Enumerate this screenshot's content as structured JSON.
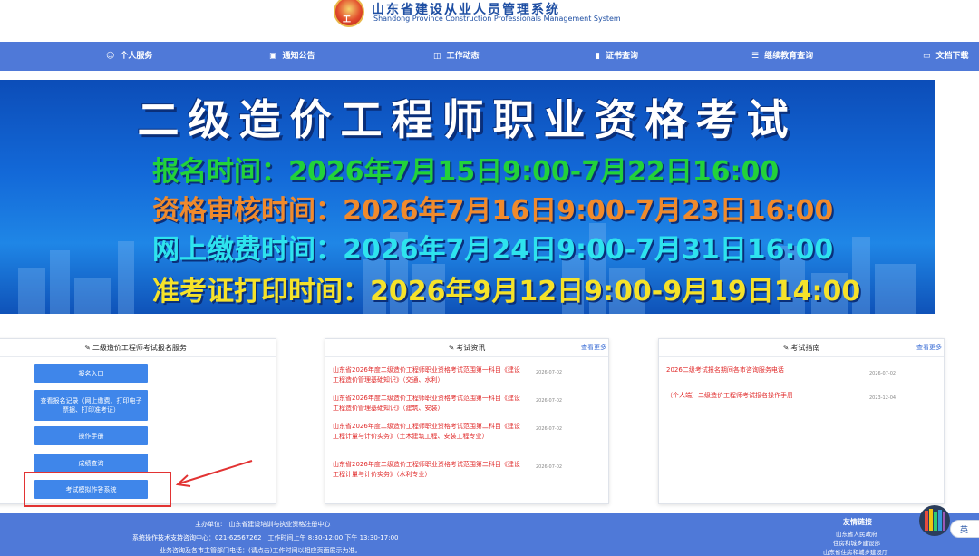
{
  "header": {
    "emblem_text": "工",
    "title": "山东省建设从业人员管理系统",
    "subtitle": "Shandong Province Construction Professionals Management System"
  },
  "nav": {
    "items": [
      {
        "label": "个人服务",
        "icon": "people-icon"
      },
      {
        "label": "通知公告",
        "icon": "notice-icon"
      },
      {
        "label": "工作动态",
        "icon": "book-icon"
      },
      {
        "label": "证书查询",
        "icon": "certificate-icon"
      },
      {
        "label": "继续教育查询",
        "icon": "list-icon"
      },
      {
        "label": "文档下载",
        "icon": "folder-icon"
      }
    ]
  },
  "banner": {
    "title": "二级造价工程师职业资格考试",
    "lines": [
      {
        "text": "报名时间：2026年7月15日9:00-7月22日16:00",
        "color": "#22d23a"
      },
      {
        "text": "资格审核时间：2026年7月16日9:00-7月23日16:00",
        "color": "#f08a2c"
      },
      {
        "text": "网上缴费时间：2026年7月24日9:00-7月31日16:00",
        "color": "#2ee3ee"
      },
      {
        "text": "准考证打印时间：2026年9月12日9:00-9月19日14:00",
        "color": "#f5e22a"
      }
    ]
  },
  "service_panel": {
    "title": "二级造价工程师考试报名服务",
    "buttons": [
      "报名入口",
      "查看报名记录（网上缴费、打印电子票据、打印准考证）",
      "操作手册",
      "成绩查询",
      "考试模拟作答系统"
    ]
  },
  "news_panel": {
    "title": "考试资讯",
    "more": "查看更多",
    "items": [
      {
        "title": "山东省2026年度二级造价工程师职业资格考试范围第一科目《建设工程造价管理基础知识》（交通、水利）",
        "date": "2026-07-02"
      },
      {
        "title": "山东省2026年度二级造价工程师职业资格考试范围第一科目《建设工程造价管理基础知识》（建筑、安装）",
        "date": "2026-07-02"
      },
      {
        "title": "山东省2026年度二级造价工程师职业资格考试范围第二科目《建设工程计量与计价实务》（土木建筑工程、安装工程专业）",
        "date": "2026-07-02"
      },
      {
        "title": "山东省2026年度二级造价工程师职业资格考试范围第二科目《建设工程计量与计价实务》（水利专业）",
        "date": "2026-07-02"
      }
    ]
  },
  "guide_panel": {
    "title": "考试指南",
    "more": "查看更多",
    "items": [
      {
        "title": "2026二级考试报名期间各市咨询服务电话",
        "date": "2026-07-02"
      },
      {
        "title": "（个人端）二级造价工程师考试报名操作手册",
        "date": "2023-12-04"
      }
    ]
  },
  "footer": {
    "sponsor": "主办单位:　山东省建设培训与执业资格注册中心",
    "support": "系统操作技术支持咨询中心：021-62567262　工作时间上午 8:30-12:00 下午 13:30-17:00",
    "business": "业务咨询及各市主管部门电话：(请点击)工作时间以相应页面展示为准。",
    "friend_title": "友情链接",
    "friend_links": [
      "山东省人民政府",
      "住房和城乡建设部",
      "山东省住房和城乡建设厅"
    ]
  },
  "widget": {
    "lang": "英"
  }
}
